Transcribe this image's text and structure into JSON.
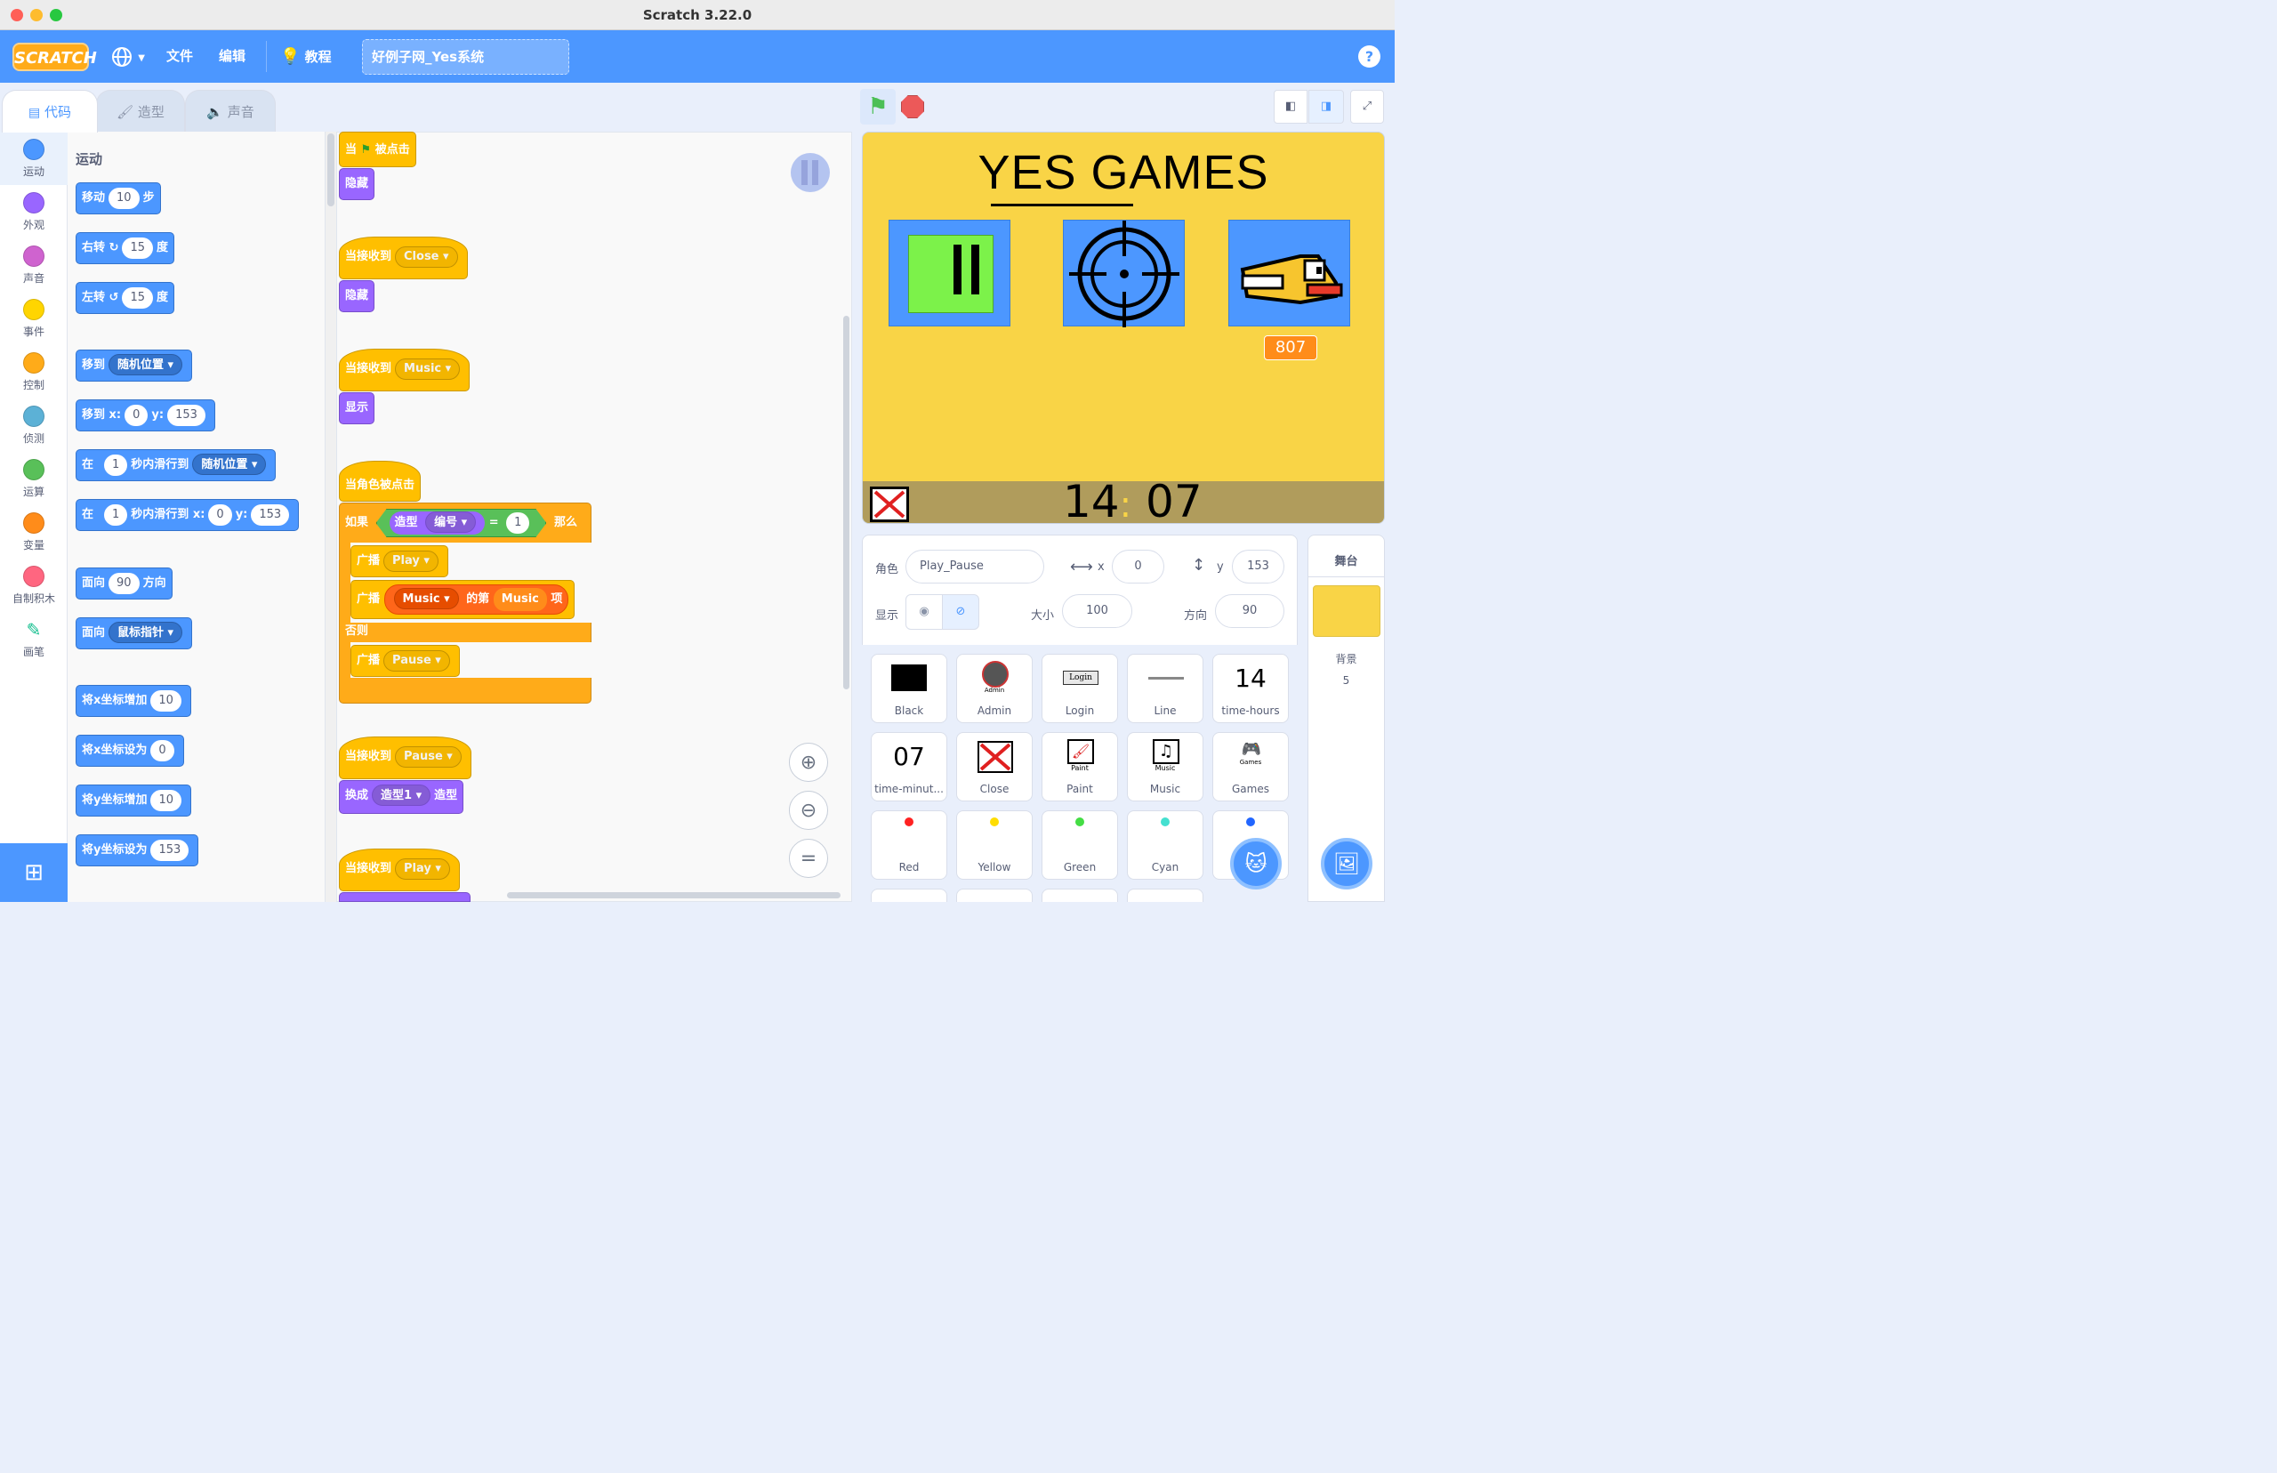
{
  "window": {
    "title": "Scratch 3.22.0"
  },
  "menubar": {
    "logo": "SCRATCH",
    "file": "文件",
    "edit": "编辑",
    "tutorials": "教程",
    "project_title": "好例子网_Yes系统",
    "help": "?"
  },
  "tabs": {
    "code": "代码",
    "costumes": "造型",
    "sounds": "声音"
  },
  "categories": [
    {
      "label": "运动",
      "color": "#4c97ff"
    },
    {
      "label": "外观",
      "color": "#9966ff"
    },
    {
      "label": "声音",
      "color": "#cf63cf"
    },
    {
      "label": "事件",
      "color": "#ffd500"
    },
    {
      "label": "控制",
      "color": "#ffab19"
    },
    {
      "label": "侦测",
      "color": "#5cb1d6"
    },
    {
      "label": "运算",
      "color": "#59c059"
    },
    {
      "label": "变量",
      "color": "#ff8c1a"
    },
    {
      "label": "自制积木",
      "color": "#ff6680"
    },
    {
      "label": "画笔",
      "color": "#0fbd8c"
    }
  ],
  "palette": {
    "title": "运动",
    "move": {
      "a": "移动",
      "v": "10",
      "b": "步"
    },
    "turn_right": {
      "a": "右转",
      "v": "15",
      "b": "度"
    },
    "turn_left": {
      "a": "左转",
      "v": "15",
      "b": "度"
    },
    "goto_random": {
      "a": "移到",
      "dd": "随机位置"
    },
    "goto_xy": {
      "a": "移到 x:",
      "x": "0",
      "yl": "y:",
      "y": "153"
    },
    "glide_random": {
      "a": "在",
      "v": "1",
      "b": "秒内滑行到",
      "dd": "随机位置"
    },
    "glide_xy": {
      "a": "在",
      "v": "1",
      "b": "秒内滑行到 x:",
      "x": "0",
      "yl": "y:",
      "y": "153"
    },
    "point_dir": {
      "a": "面向",
      "v": "90",
      "b": "方向"
    },
    "point_towards": {
      "a": "面向",
      "dd": "鼠标指针"
    },
    "change_x": {
      "a": "将x坐标增加",
      "v": "10"
    },
    "set_x": {
      "a": "将x坐标设为",
      "v": "0"
    },
    "change_y": {
      "a": "将y坐标增加",
      "v": "10"
    },
    "set_y": {
      "a": "将y坐标设为",
      "v": "153"
    }
  },
  "scripts": {
    "s1_hat": {
      "a": "当",
      "b": "被点击"
    },
    "s1_hide": "隐藏",
    "s2_hat": {
      "a": "当接收到",
      "dd": "Close"
    },
    "s2_hide": "隐藏",
    "s3_hat": {
      "a": "当接收到",
      "dd": "Music"
    },
    "s3_show": "显示",
    "s4_hat": "当角色被点击",
    "s4_if": {
      "a": "如果",
      "costume": "造型",
      "costume_dd": "编号",
      "eq": "=",
      "v": "1",
      "then": "那么"
    },
    "s4_bc1": {
      "a": "广播",
      "dd": "Play"
    },
    "s4_bc2": {
      "a": "广播",
      "list": "Music",
      "nth": "的第",
      "item": "Music",
      "b": "项"
    },
    "s4_else": "否则",
    "s4_bc3": {
      "a": "广播",
      "dd": "Pause"
    },
    "s5_hat": {
      "a": "当接收到",
      "dd": "Pause"
    },
    "s5_switch": {
      "a": "换成",
      "dd": "造型1",
      "b": "造型"
    },
    "s6_hat": {
      "a": "当接收到",
      "dd": "Play"
    }
  },
  "stage": {
    "title": "YES GAMES",
    "score": "807",
    "clock_h": "14",
    "clock_sep": ":",
    "clock_m": "07"
  },
  "sprite_info": {
    "sprite_label": "角色",
    "sprite_name": "Play_Pause",
    "x_label": "x",
    "x": "0",
    "y_label": "y",
    "y": "153",
    "show_label": "显示",
    "size_label": "大小",
    "size": "100",
    "direction_label": "方向",
    "direction": "90"
  },
  "sprites": [
    {
      "name": "Black",
      "thumb": "black-square"
    },
    {
      "name": "Admin",
      "thumb": "Admin"
    },
    {
      "name": "Login",
      "thumb": "Login"
    },
    {
      "name": "Line",
      "thumb": "line"
    },
    {
      "name": "time-hours",
      "thumb": "14"
    },
    {
      "name": "time-minut...",
      "thumb": "07"
    },
    {
      "name": "Close",
      "thumb": "x-box"
    },
    {
      "name": "Paint",
      "thumb": "Paint"
    },
    {
      "name": "Music",
      "thumb": "Music"
    },
    {
      "name": "Games",
      "thumb": "Games"
    },
    {
      "name": "Red",
      "dot": "#ff2222"
    },
    {
      "name": "Yellow",
      "dot": "#ffdd00"
    },
    {
      "name": "Green",
      "dot": "#44dd44"
    },
    {
      "name": "Cyan",
      "dot": "#44e0d0"
    },
    {
      "name": "",
      "dot": "#2266ff"
    }
  ],
  "stage_panel": {
    "title": "舞台",
    "backdrop_label": "背景",
    "backdrop_count": "5"
  }
}
